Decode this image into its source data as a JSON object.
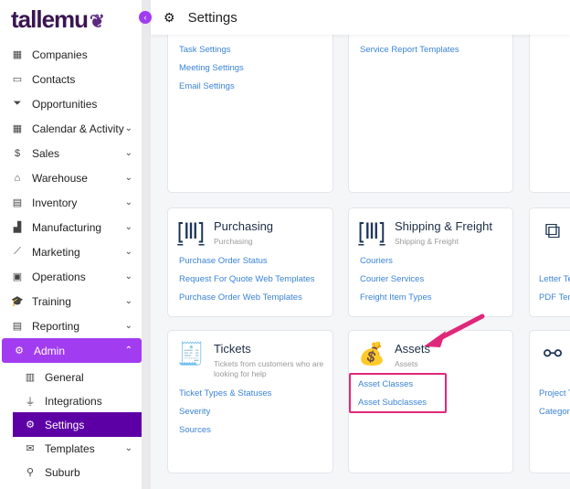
{
  "brand": {
    "name": "tallemu"
  },
  "header": {
    "title": "Settings"
  },
  "sidebar": {
    "items": [
      {
        "label": "Companies",
        "icon": "building-icon",
        "chev": ""
      },
      {
        "label": "Contacts",
        "icon": "contact-card-icon",
        "chev": ""
      },
      {
        "label": "Opportunities",
        "icon": "funnel-icon",
        "chev": ""
      },
      {
        "label": "Calendar & Activity",
        "icon": "calendar-icon",
        "chev": "⌄"
      },
      {
        "label": "Sales",
        "icon": "dollar-coin-icon",
        "chev": "⌄"
      },
      {
        "label": "Warehouse",
        "icon": "warehouse-icon",
        "chev": "⌄"
      },
      {
        "label": "Inventory",
        "icon": "inventory-icon",
        "chev": "⌄"
      },
      {
        "label": "Manufacturing",
        "icon": "factory-icon",
        "chev": "⌄"
      },
      {
        "label": "Marketing",
        "icon": "chart-line-icon",
        "chev": "⌄"
      },
      {
        "label": "Operations",
        "icon": "clipboard-icon",
        "chev": "⌄"
      },
      {
        "label": "Training",
        "icon": "graduation-cap-icon",
        "chev": "⌄"
      },
      {
        "label": "Reporting",
        "icon": "report-icon",
        "chev": "⌄"
      },
      {
        "label": "Admin",
        "icon": "gear-icon",
        "chev": "⌃"
      }
    ],
    "admin_sub": [
      {
        "label": "General",
        "icon": "buildings-icon",
        "chev": ""
      },
      {
        "label": "Integrations",
        "icon": "plug-icon",
        "chev": ""
      },
      {
        "label": "Settings",
        "icon": "gears-icon",
        "chev": ""
      },
      {
        "label": "Templates",
        "icon": "envelope-icon",
        "chev": "⌄"
      },
      {
        "label": "Suburb",
        "icon": "map-pin-icon",
        "chev": ""
      }
    ]
  },
  "cards": {
    "top_left": {
      "links": [
        "Task Settings",
        "Meeting Settings",
        "Email Settings"
      ]
    },
    "top_mid": {
      "links": [
        "Service Report Templates"
      ]
    },
    "purchasing": {
      "title": "Purchasing",
      "subtitle": "Purchasing",
      "icon": "barcode-scan-icon",
      "links": [
        "Purchase Order Status",
        "Request For Quote Web Templates",
        "Purchase Order Web Templates"
      ]
    },
    "shipping": {
      "title": "Shipping & Freight",
      "subtitle": "Shipping & Freight",
      "icon": "barcode-scan-icon",
      "links": [
        "Couriers",
        "Courier Services",
        "Freight Item Types"
      ]
    },
    "templates": {
      "icon": "copy-icon",
      "links": [
        "Letter Te",
        "PDF Tem"
      ]
    },
    "tickets": {
      "title": "Tickets",
      "subtitle": "Tickets from customers who are looking for help",
      "icon": "receipt-icon",
      "links": [
        "Ticket Types & Statuses",
        "Severity",
        "Sources"
      ]
    },
    "assets": {
      "title": "Assets",
      "subtitle": "Assets",
      "icon": "money-bag-icon",
      "links": [
        "Asset Classes",
        "Asset Subclasses"
      ]
    },
    "projects": {
      "icon": "hierarchy-icon",
      "links": [
        "Project T",
        "Categor"
      ]
    }
  },
  "annotation_color": "#e0287a",
  "accent": "#a23cf0",
  "active_color": "#5c00a6"
}
